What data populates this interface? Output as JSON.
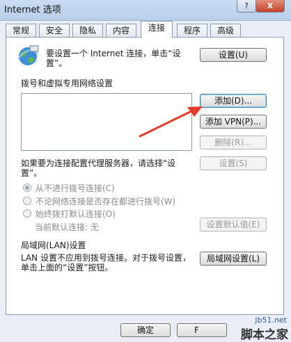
{
  "window": {
    "title": "Internet 选项",
    "help": "?",
    "close": "X"
  },
  "tabs": [
    {
      "label": "常规"
    },
    {
      "label": "安全"
    },
    {
      "label": "隐私"
    },
    {
      "label": "内容"
    },
    {
      "label": "连接"
    },
    {
      "label": "程序"
    },
    {
      "label": "高级"
    }
  ],
  "setup": {
    "text": "要设置一个 Internet 连接，单击“设置”。",
    "button": "设置(U)"
  },
  "dialup": {
    "heading": "拨号和虚拟专用网络设置",
    "add": "添加(D)...",
    "add_vpn": "添加 VPN(P)...",
    "remove": "删除(R)...",
    "settings": "设置(S)",
    "proxy_text": "如果要为连接配置代理服务器，请选择“设置”。",
    "options": [
      {
        "label": "从不进行拨号连接(C)"
      },
      {
        "label": "不论网络连接是否存在都进行拨号(W)"
      },
      {
        "label": "始终拨打默认连接(O)"
      }
    ],
    "current_label": "当前默认连接:  无",
    "set_default": "设置默认值(E)"
  },
  "lan": {
    "heading": "局域网(LAN)设置",
    "text": "LAN 设置不应用到拨号连接。对于拨号设置，单击上面的“设置”按钮。",
    "button": "局域网设置(L)"
  },
  "footer": {
    "ok": "确定",
    "cancel": "F"
  },
  "watermark": {
    "url": "jb51.net",
    "name": "脚本之家"
  },
  "colors": {
    "accent": "#3c7fb1",
    "arrow": "#e53b2a",
    "title_bg": "#c9dcf2"
  }
}
